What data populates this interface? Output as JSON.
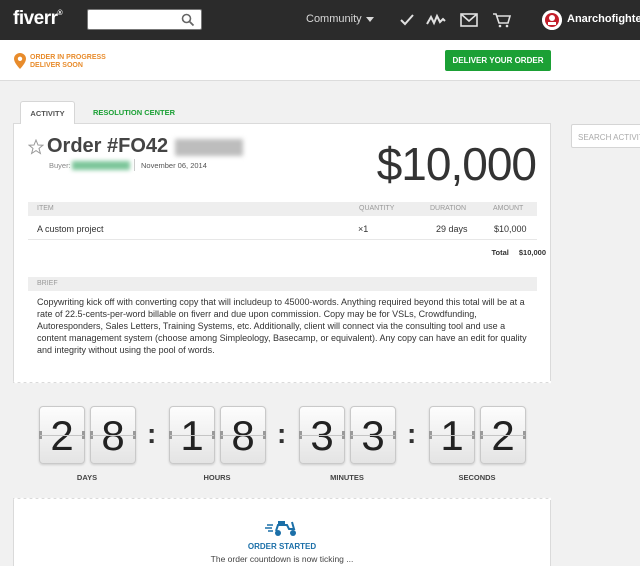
{
  "nav": {
    "logo": "fiverr",
    "logo_mark": "®",
    "search_placeholder": "",
    "community_label": "Community",
    "username": "Anarchofighter"
  },
  "status": {
    "line1": "ORDER IN PROGRESS",
    "line2": "DELIVER SOON",
    "deliver_label": "DELIVER YOUR ORDER"
  },
  "tabs": {
    "activity": "ACTIVITY",
    "resolution": "RESOLUTION CENTER"
  },
  "side": {
    "search_activity_placeholder": "SEARCH ACTIVITY"
  },
  "order": {
    "title_prefix": "Order #FO42",
    "buyer_label": "Buyer:",
    "date": "November 06, 2014",
    "price": "$10,000",
    "headers": {
      "item": "ITEM",
      "quantity": "QUANTITY",
      "duration": "DURATION",
      "amount": "AMOUNT"
    },
    "row": {
      "item": "A custom project",
      "quantity": "×1",
      "duration": "29 days",
      "amount": "$10,000"
    },
    "total_label": "Total",
    "total_value": "$10,000",
    "brief_label": "BRIEF",
    "brief_text": "Copywriting kick off with converting copy that will includeup to 45000-words. Anything required beyond this total will be at a rate of 22.5-cents-per-word billable on fiverr and due upon commission. Copy may be for VSLs, Crowdfunding, Autoresponders, Sales Letters, Training Systems, etc. Additionally, client will connect via the consulting tool and use a content management system (choose among Simpleology, Basecamp, or equivalent). Any copy can have an edit for quality and integrity without using the pool of words."
  },
  "countdown": {
    "digits": [
      "2",
      "8",
      "1",
      "8",
      "3",
      "3",
      "1",
      "2"
    ],
    "separator": ":",
    "units": [
      "DAYS",
      "HOURS",
      "MINUTES",
      "SECONDS"
    ]
  },
  "activity": {
    "started_label": "ORDER STARTED",
    "ticking_text": "The order countdown is now ticking ..."
  },
  "colors": {
    "nav_bg": "#2b2b2b",
    "brand_green": "#1ba035",
    "status_orange": "#e88c2c",
    "activity_blue": "#1b6fa8"
  },
  "icons": [
    "search-icon",
    "checkmark-icon",
    "analytics-icon",
    "mail-icon",
    "cart-icon",
    "location-pin-icon",
    "star-icon",
    "scooter-icon"
  ]
}
